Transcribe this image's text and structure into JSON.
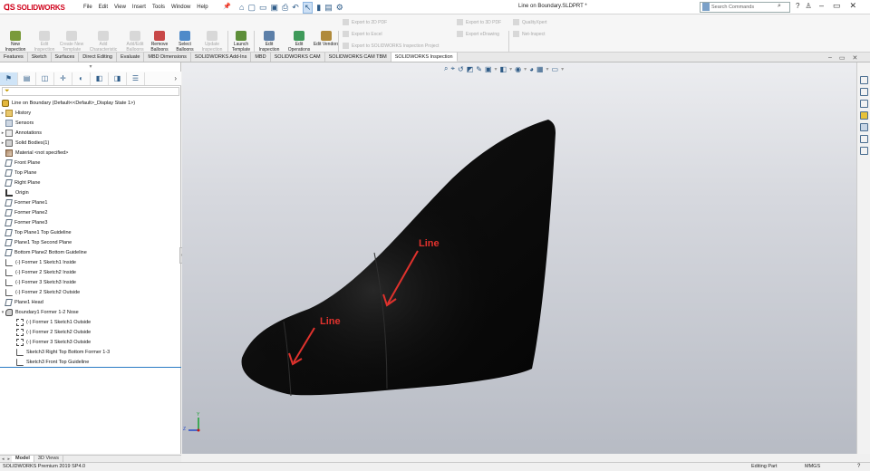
{
  "app": {
    "brand": "SOLIDWORKS",
    "document_title": "Line on Boundary.SLDPRT *",
    "search_placeholder": "Search Commands",
    "menus": [
      "File",
      "Edit",
      "View",
      "Insert",
      "Tools",
      "Window",
      "Help"
    ]
  },
  "ribbon": {
    "large_buttons": [
      {
        "label": "New Inspection Project",
        "enabled": true
      },
      {
        "label": "Edit Inspection Project",
        "enabled": false
      },
      {
        "label": "Create New Template",
        "enabled": false
      },
      {
        "label": "Add Characteristic",
        "enabled": false
      },
      {
        "label": "Add/Edit Balloons",
        "enabled": false
      },
      {
        "label": "Remove Balloons",
        "enabled": true
      },
      {
        "label": "Select Balloons",
        "enabled": true
      },
      {
        "label": "Update Inspection Project",
        "enabled": false
      },
      {
        "label": "Launch Template Editor",
        "enabled": true
      },
      {
        "label": "Edit Inspection Methods",
        "enabled": true
      },
      {
        "label": "Edit Operations",
        "enabled": true
      },
      {
        "label": "Edit Vendors",
        "enabled": true
      }
    ],
    "small_buttons": [
      "Export to 2D PDF",
      "Export to Excel",
      "Export to SOLIDWORKS Inspection Project",
      "Export to 3D PDF",
      "Export eDrawing",
      "QualityXpert",
      "Net-Inspect"
    ]
  },
  "tabs": [
    {
      "label": "Features",
      "active": false
    },
    {
      "label": "Sketch",
      "active": false
    },
    {
      "label": "Surfaces",
      "active": false
    },
    {
      "label": "Direct Editing",
      "active": false
    },
    {
      "label": "Evaluate",
      "active": false
    },
    {
      "label": "MBD Dimensions",
      "active": false
    },
    {
      "label": "SOLIDWORKS Add-Ins",
      "active": false
    },
    {
      "label": "MBD",
      "active": false
    },
    {
      "label": "SOLIDWORKS CAM",
      "active": false
    },
    {
      "label": "SOLIDWORKS CAM TBM",
      "active": false
    },
    {
      "label": "SOLIDWORKS Inspection",
      "active": true
    }
  ],
  "tree": {
    "root": "Line on Boundary  (Default<<Default>_Display State 1>)",
    "items": [
      {
        "label": "History",
        "icon": "folder-icon",
        "expand": "▸"
      },
      {
        "label": "Sensors",
        "icon": "sensor-icon",
        "expand": ""
      },
      {
        "label": "Annotations",
        "icon": "annotation-icon",
        "expand": "▸"
      },
      {
        "label": "Solid Bodies(1)",
        "icon": "solid-body-icon",
        "expand": "▸"
      },
      {
        "label": "Material <not specified>",
        "icon": "material-icon",
        "expand": ""
      },
      {
        "label": "Front Plane",
        "icon": "plane-icon",
        "expand": ""
      },
      {
        "label": "Top Plane",
        "icon": "plane-icon",
        "expand": ""
      },
      {
        "label": "Right Plane",
        "icon": "plane-icon",
        "expand": ""
      },
      {
        "label": "Origin",
        "icon": "origin-icon",
        "expand": ""
      },
      {
        "label": "Former Plane1",
        "icon": "plane-icon",
        "expand": ""
      },
      {
        "label": "Former Plane2",
        "icon": "plane-icon",
        "expand": ""
      },
      {
        "label": "Former Plane3",
        "icon": "plane-icon",
        "expand": ""
      },
      {
        "label": "Top Plane1 Top Guideline",
        "icon": "plane-icon",
        "expand": ""
      },
      {
        "label": "Plane1 Top Second Plane",
        "icon": "plane-icon",
        "expand": ""
      },
      {
        "label": "Bottom Plane2 Bottom Guideline",
        "icon": "plane-icon",
        "expand": ""
      },
      {
        "label": "(-) Former 1 Sketch1 Inside",
        "icon": "sketch-icon",
        "expand": ""
      },
      {
        "label": "(-) Former 2 Sketch2 Inside",
        "icon": "sketch-icon",
        "expand": ""
      },
      {
        "label": "(-) Former 3 Sketch3 Inside",
        "icon": "sketch-icon",
        "expand": ""
      },
      {
        "label": "(-) Former 2 Sketch2 Outside",
        "icon": "sketch-icon",
        "expand": ""
      },
      {
        "label": "Plane1 Head",
        "icon": "plane-icon",
        "expand": ""
      },
      {
        "label": "Boundary1 Former 1-2 Nose",
        "icon": "boundary-icon",
        "expand": "▾"
      }
    ],
    "children": [
      {
        "label": "(-) Former 1 Sketch1 Outside",
        "icon": "dashed-sketch-icon"
      },
      {
        "label": "(-) Former 2 Sketch2 Outside",
        "icon": "dashed-sketch-icon"
      },
      {
        "label": "(-) Former 3 Sketch3 Outside",
        "icon": "dashed-sketch-icon"
      },
      {
        "label": "Sketch3 Right Top Bottom Former 1-3",
        "icon": "sketch-icon"
      },
      {
        "label": "Sketch3 Front Top Guideline",
        "icon": "sketch-icon"
      }
    ]
  },
  "model_tabs": [
    {
      "label": "Model",
      "active": true
    },
    {
      "label": "3D Views",
      "active": false
    }
  ],
  "viewport": {
    "callout_1": "Line",
    "callout_2": "Line",
    "triad_axis_y": "Y",
    "triad_axis_z": "Z",
    "accent_color": "#e0322d"
  },
  "status": {
    "left": "SOLIDWORKS Premium 2019 SP4.0",
    "mode": "Editing Part",
    "units": "MMGS",
    "help": "?"
  }
}
